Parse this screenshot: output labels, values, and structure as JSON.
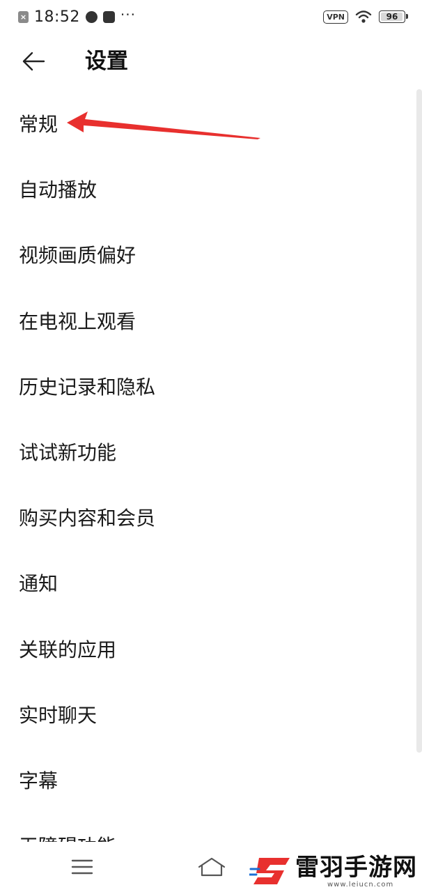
{
  "status_bar": {
    "time": "18:52",
    "dots": "···",
    "vpn": "VPN",
    "battery": "96",
    "battery_level_percent": 96
  },
  "header": {
    "title": "设置",
    "back_icon": "arrow-left-icon"
  },
  "settings_items": [
    {
      "label": "常规"
    },
    {
      "label": "自动播放"
    },
    {
      "label": "视频画质偏好"
    },
    {
      "label": "在电视上观看"
    },
    {
      "label": "历史记录和隐私"
    },
    {
      "label": "试试新功能"
    },
    {
      "label": "购买内容和会员"
    },
    {
      "label": "通知"
    },
    {
      "label": "关联的应用"
    },
    {
      "label": "实时聊天"
    },
    {
      "label": "字幕"
    },
    {
      "label": "无障碍功能"
    }
  ],
  "annotation": {
    "color": "#e8302e"
  },
  "nav_bar": {
    "menu_icon": "menu-icon",
    "home_icon": "home-icon"
  },
  "watermark": {
    "name": "雷羽手游网",
    "url": "www.leiucn.com",
    "logo_color": "#e8302e"
  }
}
